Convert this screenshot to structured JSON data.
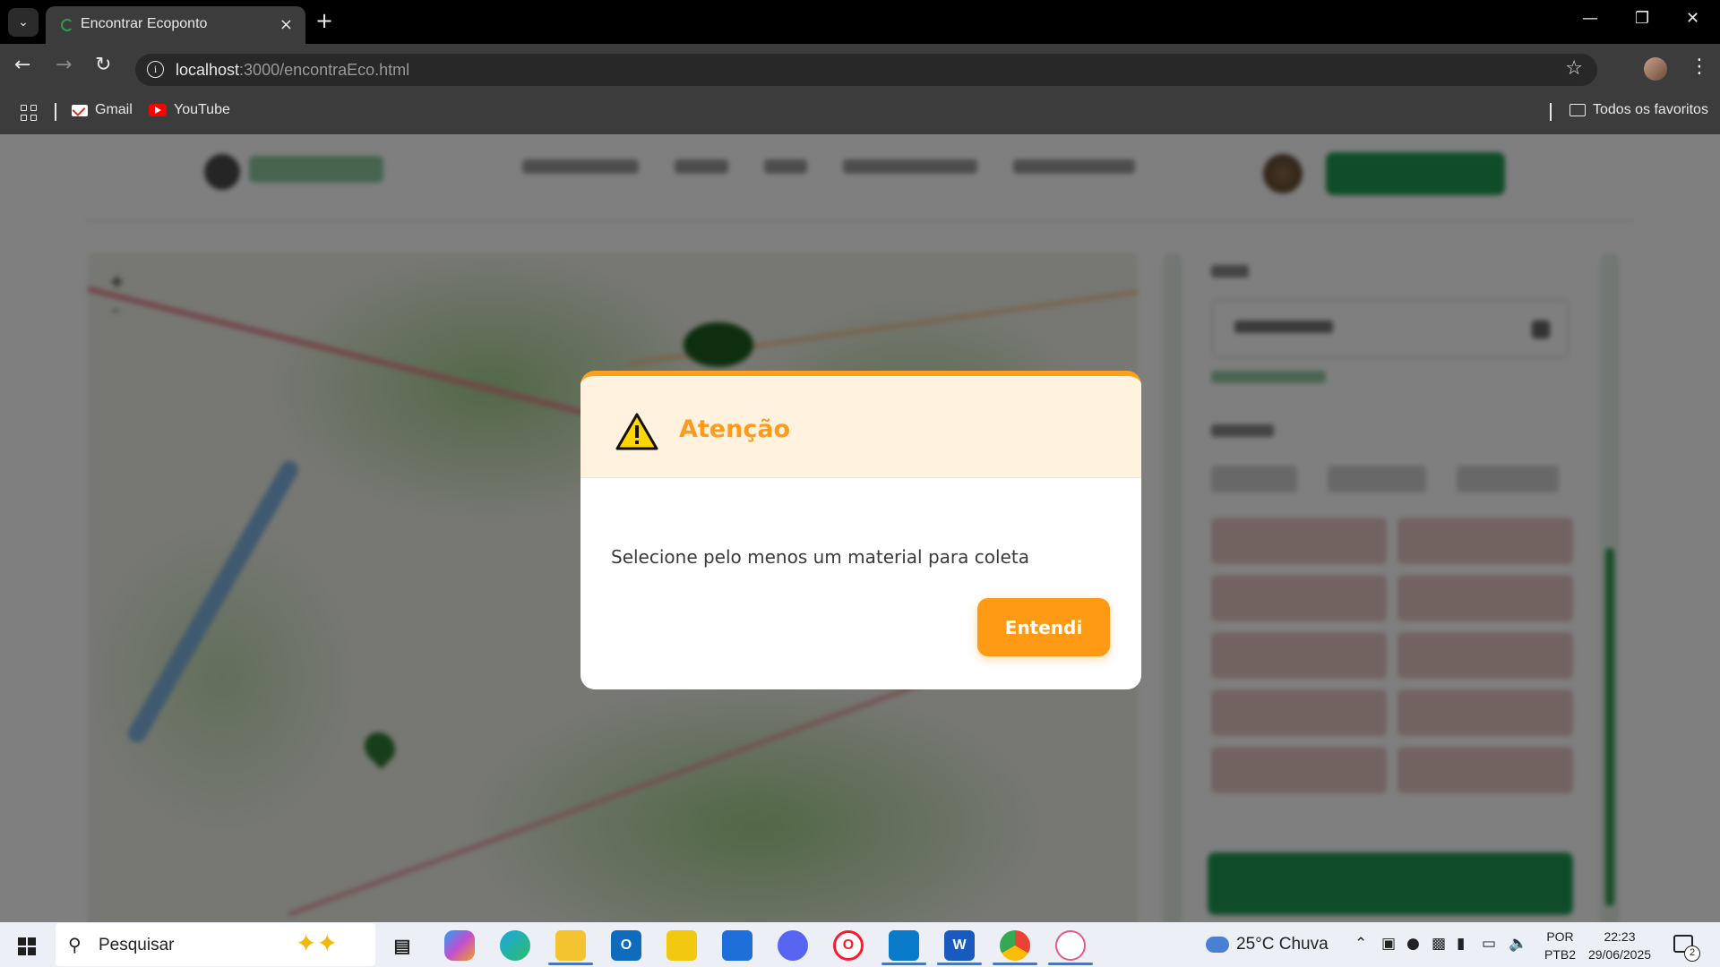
{
  "browser": {
    "tab_title": "Encontrar Ecoponto",
    "tab_close": "×",
    "new_tab": "+",
    "url_host": "localhost",
    "url_path": ":3000/encontraEco.html",
    "bookmarks": [
      {
        "label": "Gmail",
        "icon": "gmail-icon"
      },
      {
        "label": "YouTube",
        "icon": "youtube-icon"
      }
    ],
    "all_bookmarks": "Todos os favoritos"
  },
  "modal": {
    "title": "Atenção",
    "icon": "warning-icon",
    "message": "Selecione pelo menos um material para coleta",
    "button": "Entendi",
    "accent_color": "#ff9a14",
    "header_bg": "#fff3e0"
  },
  "taskbar": {
    "search_placeholder": "Pesquisar",
    "weather": "25°C  Chuva",
    "lang_line1": "POR",
    "lang_line2": "PTB2",
    "time": "22:23",
    "date": "29/06/2025",
    "notification_count": "2",
    "apps": [
      {
        "name": "task-view",
        "label": ""
      },
      {
        "name": "copilot",
        "label": ""
      },
      {
        "name": "edge",
        "label": ""
      },
      {
        "name": "file-explorer",
        "label": ""
      },
      {
        "name": "outlook",
        "label": "O"
      },
      {
        "name": "power-bi",
        "label": ""
      },
      {
        "name": "microsoft-store",
        "label": ""
      },
      {
        "name": "discord",
        "label": ""
      },
      {
        "name": "opera",
        "label": "O"
      },
      {
        "name": "vscode",
        "label": ""
      },
      {
        "name": "word",
        "label": "W"
      },
      {
        "name": "chrome",
        "label": ""
      },
      {
        "name": "snipping-tool",
        "label": ""
      }
    ]
  }
}
